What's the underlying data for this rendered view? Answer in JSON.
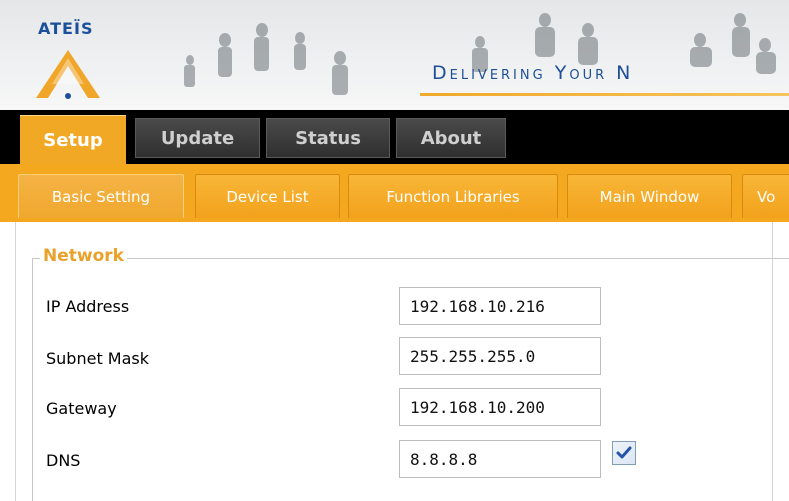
{
  "brand": {
    "name": "ATEÏS",
    "tagline": "Delivering Your N"
  },
  "colors": {
    "accent_orange": "#f3a81f",
    "brand_blue": "#1b4f9b",
    "header_black": "#000000",
    "legend_orange": "#e9a12a"
  },
  "main_tabs": [
    {
      "label": "Setup",
      "active": true
    },
    {
      "label": "Update",
      "active": false
    },
    {
      "label": "Status",
      "active": false
    },
    {
      "label": "About",
      "active": false
    }
  ],
  "sub_tabs": [
    {
      "label": "Basic Setting",
      "active": true
    },
    {
      "label": "Device List",
      "active": false
    },
    {
      "label": "Function Libraries",
      "active": false
    },
    {
      "label": "Main Window",
      "active": false
    },
    {
      "label": "Vo",
      "active": false
    }
  ],
  "network": {
    "legend": "Network",
    "fields": [
      {
        "label": "IP Address",
        "value": "192.168.10.216"
      },
      {
        "label": "Subnet Mask",
        "value": "255.255.255.0"
      },
      {
        "label": "Gateway",
        "value": "192.168.10.200"
      },
      {
        "label": "DNS",
        "value": "8.8.8.8"
      }
    ],
    "dns_checkbox_checked": true
  },
  "icons": {
    "logo": "ateis-triangle-logo-icon",
    "checkbox": "checkmark-icon"
  }
}
